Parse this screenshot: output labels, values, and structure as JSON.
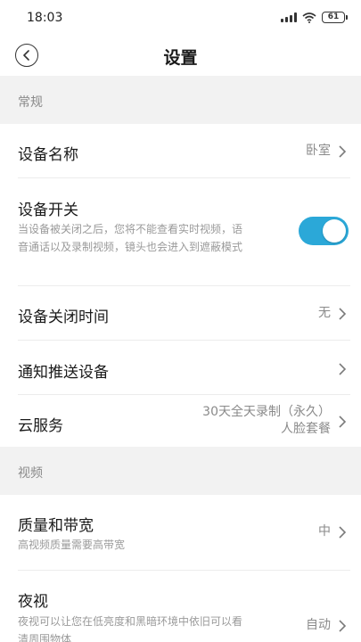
{
  "status_bar": {
    "time": "18:03",
    "battery": "61",
    "icons": [
      "signal-icon",
      "wifi-icon",
      "battery-icon"
    ]
  },
  "header": {
    "title": "设置",
    "back_icon": "back-arrow-icon"
  },
  "sections": {
    "general": {
      "header": "常规",
      "device_name": {
        "label": "设备名称",
        "value": "卧室"
      },
      "device_switch": {
        "label": "设备开关",
        "desc_line1": "当设备被关闭之后，您将不能查看实时视频，语",
        "desc_line2": "音通话以及录制视频，镜头也会进入到遮蔽模式",
        "enabled": true
      },
      "shutdown_time": {
        "label": "设备关闭时间",
        "value": "无"
      },
      "notify_devices": {
        "label": "通知推送设备"
      },
      "cloud": {
        "label": "云服务",
        "value_line1": "30天全天录制（永久）",
        "value_line2": "人脸套餐"
      }
    },
    "video": {
      "header": "视频",
      "quality": {
        "label": "质量和带宽",
        "desc": "高视频质量需要高带宽",
        "value": "中"
      },
      "night_vision": {
        "label": "夜视",
        "desc_line1": "夜视可以让您在低亮度和黑暗环境中依旧可以看",
        "desc_line2": "清周围物体",
        "value": "自动"
      }
    }
  },
  "colors": {
    "accent": "#2ba8d8",
    "section_bg": "#f2f2f2",
    "text_secondary": "#9a9a9a"
  }
}
